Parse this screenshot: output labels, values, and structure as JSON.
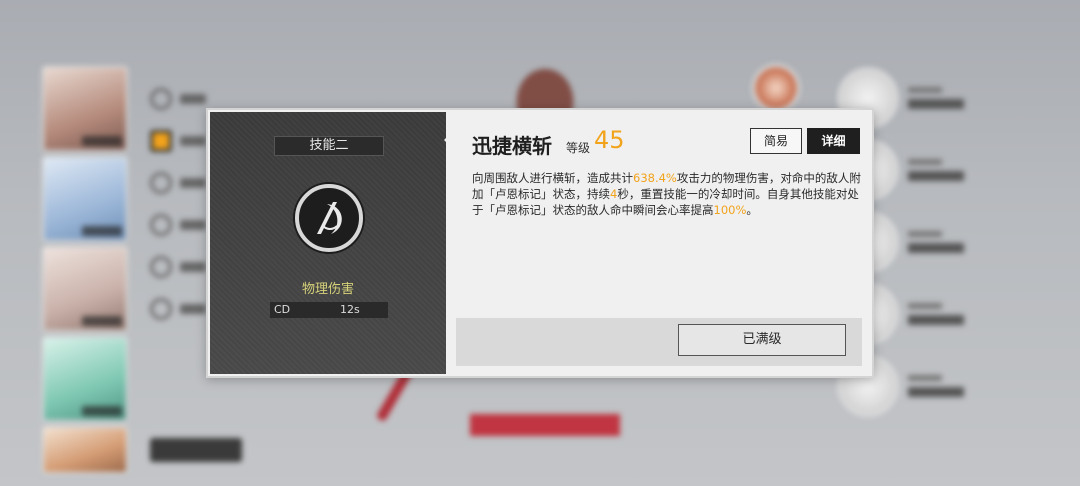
{
  "skill_panel": {
    "slot_label": "技能二",
    "damage_type": "物理伤害",
    "cd_label": "CD",
    "cd_value": "12s",
    "title": "迅捷横斩",
    "level_label": "等级",
    "level_value": "45",
    "tab_simple": "简易",
    "tab_detail": "详细",
    "description": {
      "p1": "向周围敌人进行横斩，造成共计",
      "v1": "638.4%",
      "p2": "攻击力的物理伤害，对命中的敌人附加「卢恩标记」状态，持续",
      "v2": "4",
      "p3": "秒，重置技能一的冷却时间。自身其他技能对处于「卢恩标记」状态的敌人命中瞬间会心率提高",
      "v3": "100%",
      "p4": "。"
    },
    "max_button": "已满级"
  },
  "colors": {
    "accent": "#f2a31c",
    "damage_type": "#d7d27a",
    "panel_dark": "#3c3c3c",
    "panel_light": "#f0f0f0"
  },
  "icons": {
    "skill_emblem": "crescent-slash-icon",
    "callout_arrow": "pointer-arrow-icon"
  }
}
